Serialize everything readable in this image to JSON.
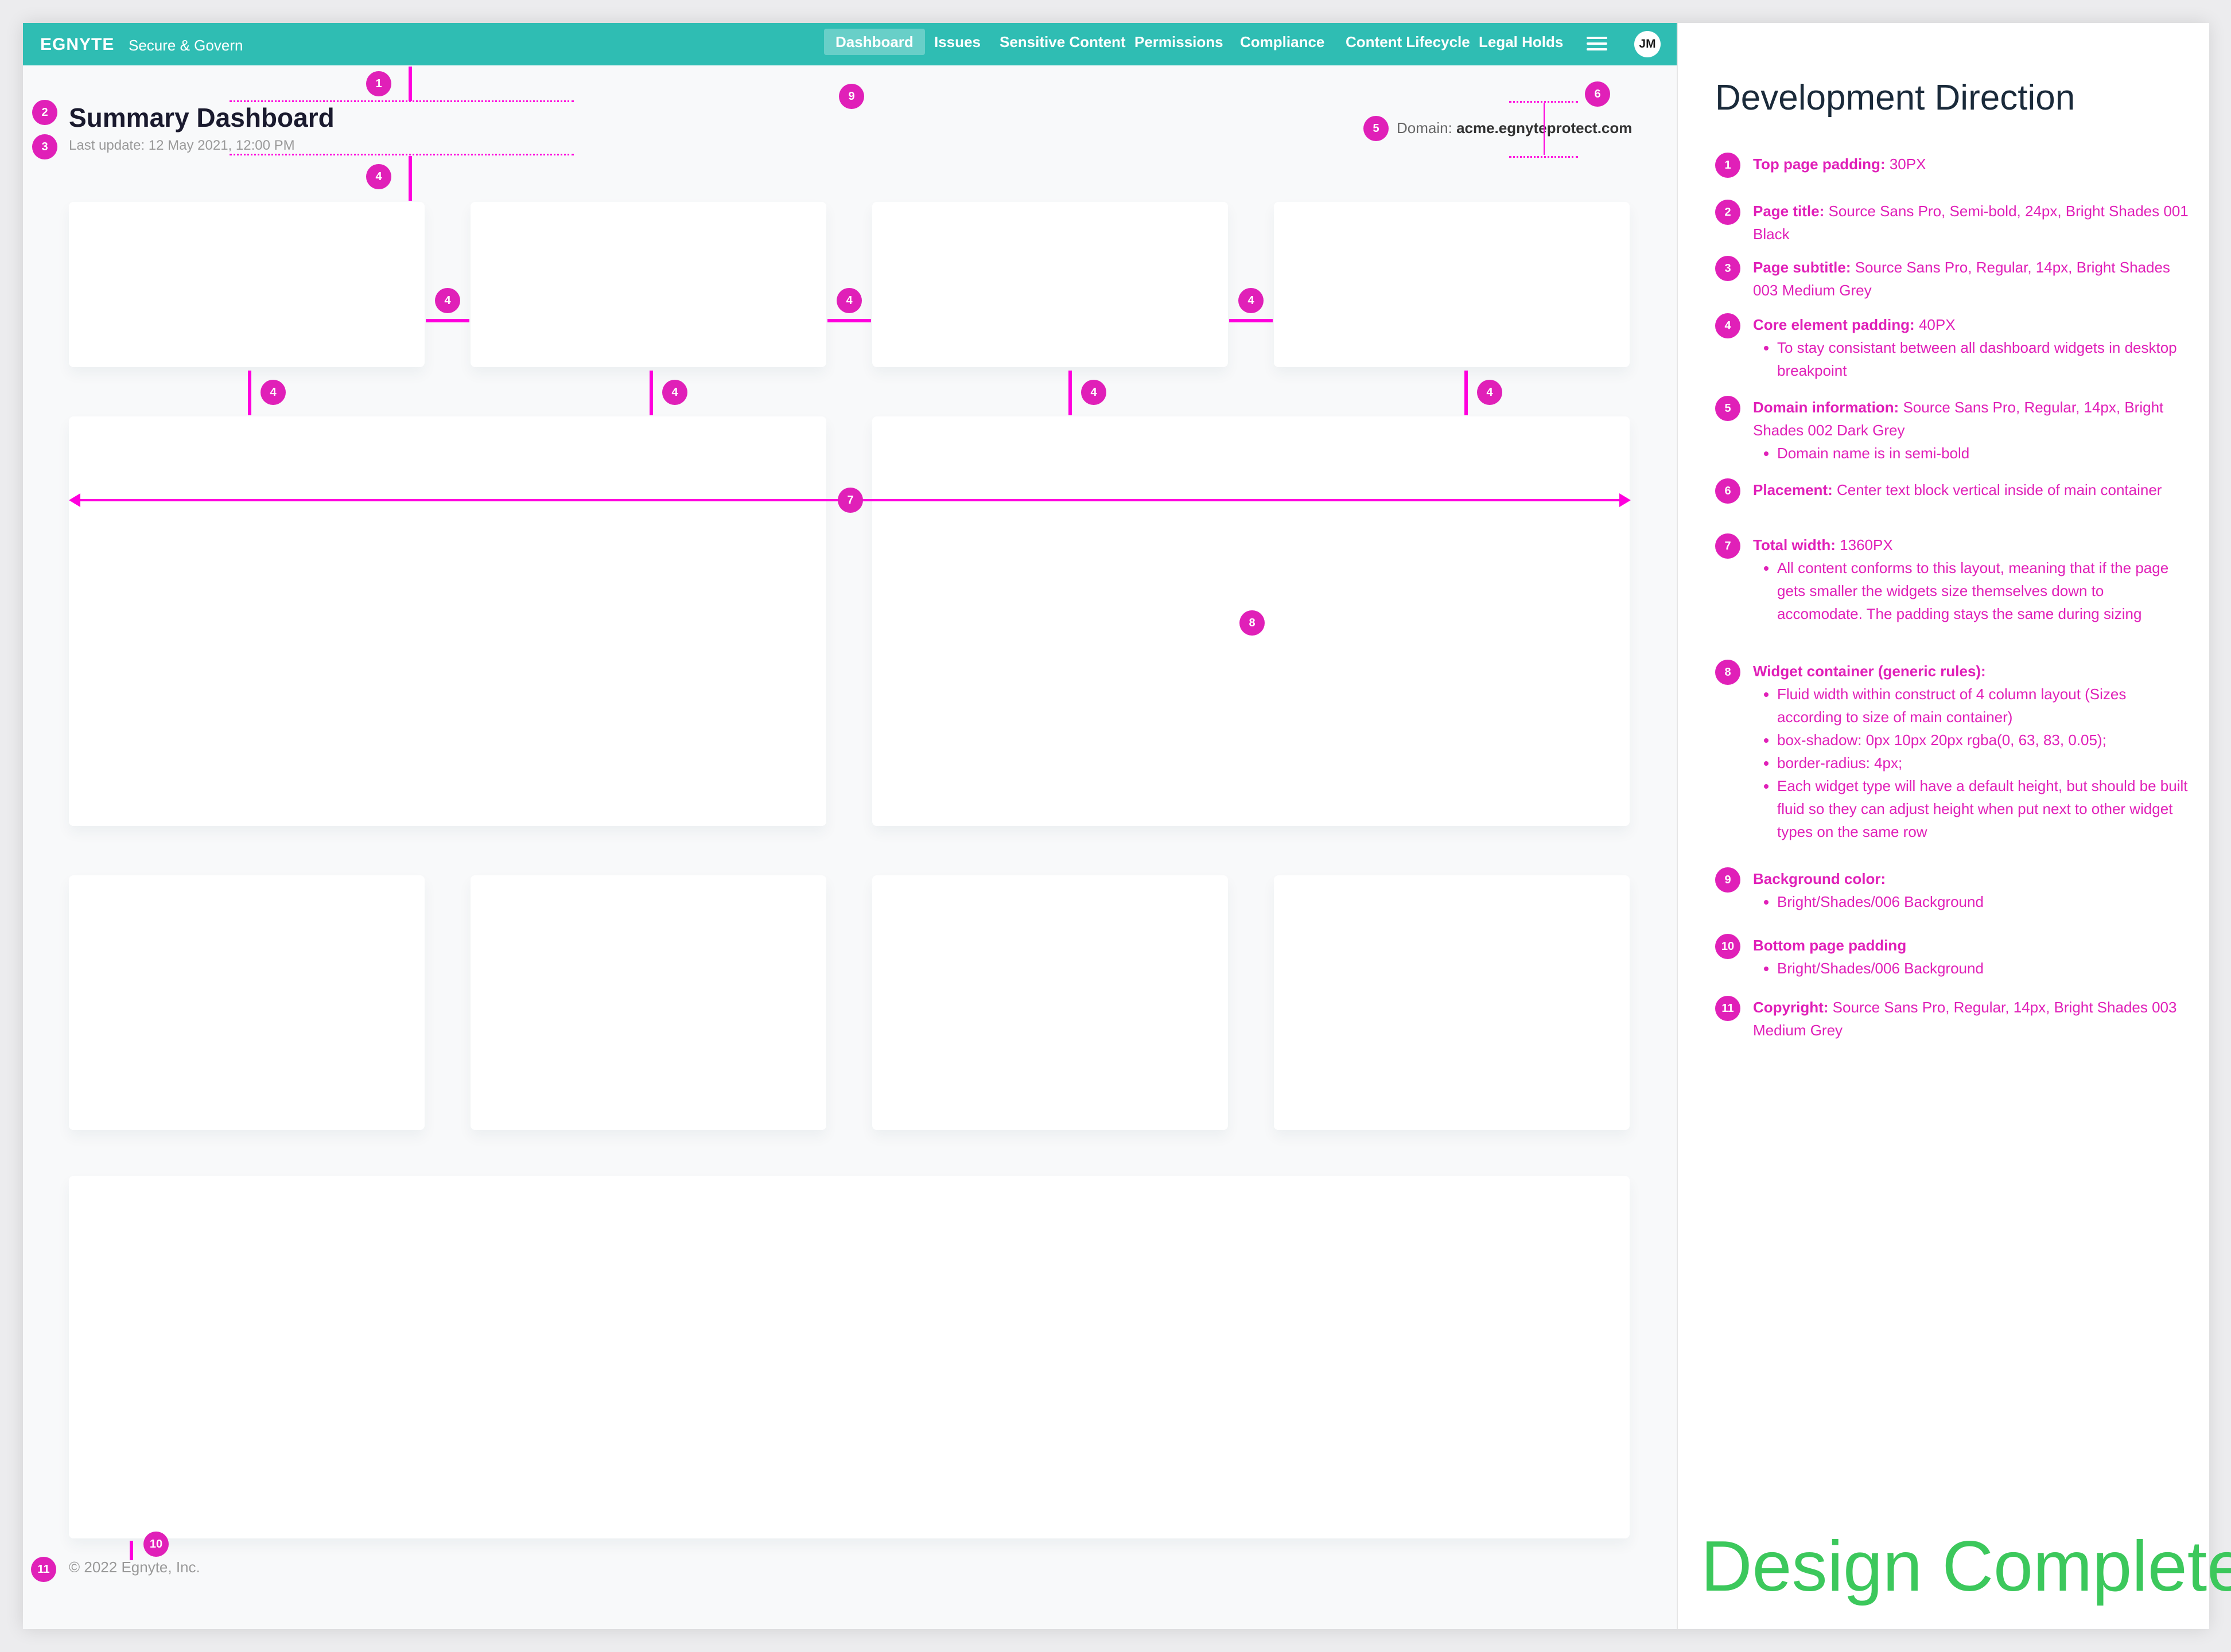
{
  "navbar": {
    "logo": "EGNYTE",
    "product": "Secure & Govern",
    "items": [
      {
        "label": "Dashboard",
        "active": true
      },
      {
        "label": "Issues"
      },
      {
        "label": "Sensitive Content"
      },
      {
        "label": "Permissions"
      },
      {
        "label": "Compliance"
      },
      {
        "label": "Content Lifecycle"
      },
      {
        "label": "Legal Holds"
      }
    ],
    "menu_icon": "hamburger-icon",
    "avatar": "JM"
  },
  "page": {
    "title": "Summary Dashboard",
    "subtitle": "Last update: 12 May 2021, 12:00 PM",
    "domain_label": "Domain:",
    "domain_value": "acme.egnyteprotect.com",
    "copyright": "© 2022 Egnyte, Inc."
  },
  "annotations": {
    "n1": "1",
    "n2": "2",
    "n3": "3",
    "n4": "4",
    "n5": "5",
    "n6": "6",
    "n7": "7",
    "n8": "8",
    "n9": "9",
    "n10": "10",
    "n11": "11"
  },
  "panel": {
    "title": "Development Direction",
    "notes": [
      {
        "num": "1",
        "label": "Top page padding:",
        "text": "30PX"
      },
      {
        "num": "2",
        "label": "Page title:",
        "text": "Source Sans Pro, Semi-bold, 24px, Bright Shades 001 Black"
      },
      {
        "num": "3",
        "label": "Page subtitle:",
        "text": "Source Sans Pro, Regular, 14px, Bright Shades 003 Medium Grey"
      },
      {
        "num": "4",
        "label": "Core element padding:",
        "text": "40PX",
        "bullets": [
          "To stay consistant between all dashboard widgets in desktop breakpoint"
        ]
      },
      {
        "num": "5",
        "label": "Domain information:",
        "text": "Source Sans Pro, Regular, 14px, Bright Shades 002 Dark Grey",
        "bullets": [
          "Domain name is in semi-bold"
        ]
      },
      {
        "num": "6",
        "label": "Placement:",
        "text": "Center text block vertical inside of main container"
      },
      {
        "num": "7",
        "label": "Total width:",
        "text": "1360PX",
        "bullets": [
          "All content conforms to this layout, meaning that if the page gets smaller the widgets size themselves down to accomodate. The padding stays the same during sizing"
        ]
      },
      {
        "num": "8",
        "label": "Widget container (generic rules):",
        "text": "",
        "bullets": [
          "Fluid width within construct of 4 column layout (Sizes according to size of main container)",
          "box-shadow: 0px 10px 20px rgba(0, 63, 83, 0.05);",
          "border-radius: 4px;",
          "Each widget type will have a default height, but should be built fluid so they can adjust height when put next to other widget types on the same row"
        ]
      },
      {
        "num": "9",
        "label": "Background color:",
        "text": "",
        "bullets": [
          "Bright/Shades/006 Background"
        ]
      },
      {
        "num": "10",
        "label": "Bottom page padding",
        "text": "",
        "bullets": [
          "Bright/Shades/006 Background"
        ]
      },
      {
        "num": "11",
        "label": "Copyright:",
        "text": "Source Sans Pro, Regular, 14px, Bright Shades 003 Medium Grey"
      }
    ],
    "status": "Design Complete"
  },
  "colors": {
    "nav": "#2fbdb3",
    "annotation": "#e020b8",
    "background": "#f8f9fa",
    "status": "#3cc85c"
  }
}
